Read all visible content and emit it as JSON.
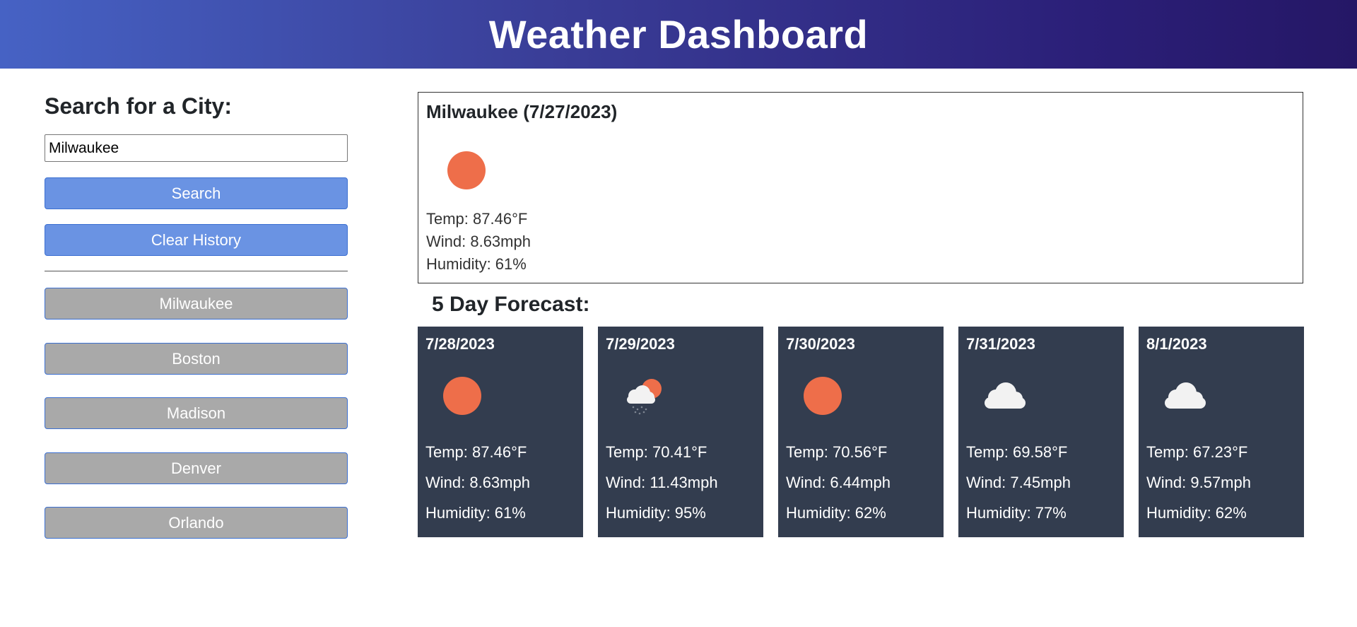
{
  "header": {
    "title": "Weather Dashboard"
  },
  "sidebar": {
    "heading": "Search for a City:",
    "search_value": "Milwaukee",
    "search_button": "Search",
    "clear_button": "Clear History",
    "history": [
      "Milwaukee",
      "Boston",
      "Madison",
      "Denver",
      "Orlando"
    ]
  },
  "current": {
    "title": "Milwaukee (7/27/2023)",
    "icon": "sun-icon",
    "temp": "Temp: 87.46°F",
    "wind": "Wind: 8.63mph",
    "humidity": "Humidity: 61%"
  },
  "forecast": {
    "title": "5 Day Forecast:",
    "days": [
      {
        "date": "7/28/2023",
        "icon": "sun-icon",
        "temp": "Temp: 87.46°F",
        "wind": "Wind: 8.63mph",
        "humidity": "Humidity: 61%"
      },
      {
        "date": "7/29/2023",
        "icon": "rain-cloud-sun-icon",
        "temp": "Temp: 70.41°F",
        "wind": "Wind: 11.43mph",
        "humidity": "Humidity: 95%"
      },
      {
        "date": "7/30/2023",
        "icon": "sun-icon",
        "temp": "Temp: 70.56°F",
        "wind": "Wind: 6.44mph",
        "humidity": "Humidity: 62%"
      },
      {
        "date": "7/31/2023",
        "icon": "cloud-icon",
        "temp": "Temp: 69.58°F",
        "wind": "Wind: 7.45mph",
        "humidity": "Humidity: 77%"
      },
      {
        "date": "8/1/2023",
        "icon": "cloud-icon",
        "temp": "Temp: 67.23°F",
        "wind": "Wind: 9.57mph",
        "humidity": "Humidity: 62%"
      }
    ]
  },
  "colors": {
    "sun": "#ee6e4a",
    "cloud": "#f2f2f2",
    "card_bg": "#333d4f",
    "primary_button": "#6a93e3",
    "history_button": "#a9a9a9"
  }
}
